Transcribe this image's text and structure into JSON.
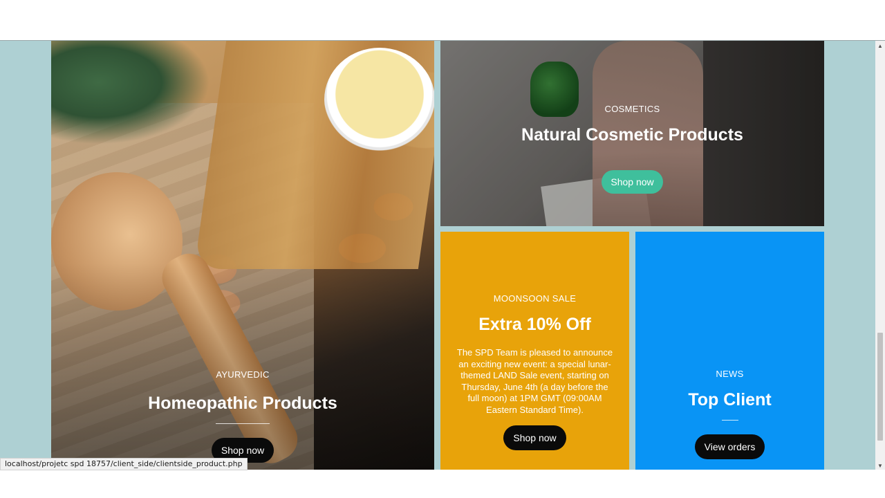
{
  "cards": {
    "ayurvedic": {
      "eyebrow": "AYURVEDIC",
      "title": "Homeopathic Products",
      "button": "Shop now"
    },
    "cosmetics": {
      "eyebrow": "COSMETICS",
      "title": "Natural Cosmetic Products",
      "button": "Shop now"
    },
    "sale": {
      "eyebrow": "MOONSOON SALE",
      "title": "Extra 10% Off",
      "text": "The SPD Team is pleased to announce an exciting new event: a special lunar-themed LAND Sale event, starting on Thursday, June 4th (a day before the full moon) at 1PM GMT (09:00AM Eastern Standard Time).",
      "button": "Shop now"
    },
    "news": {
      "eyebrow": "NEWS",
      "title": "Top Client",
      "button": "View orders"
    }
  },
  "status_bar": {
    "url": "localhost/projetc spd 18757/client_side/clientside_product.php"
  },
  "colors": {
    "background": "#aed0d3",
    "sale": "#e8a30a",
    "news": "#0994f5",
    "teal_button": "#3fbf9c"
  }
}
